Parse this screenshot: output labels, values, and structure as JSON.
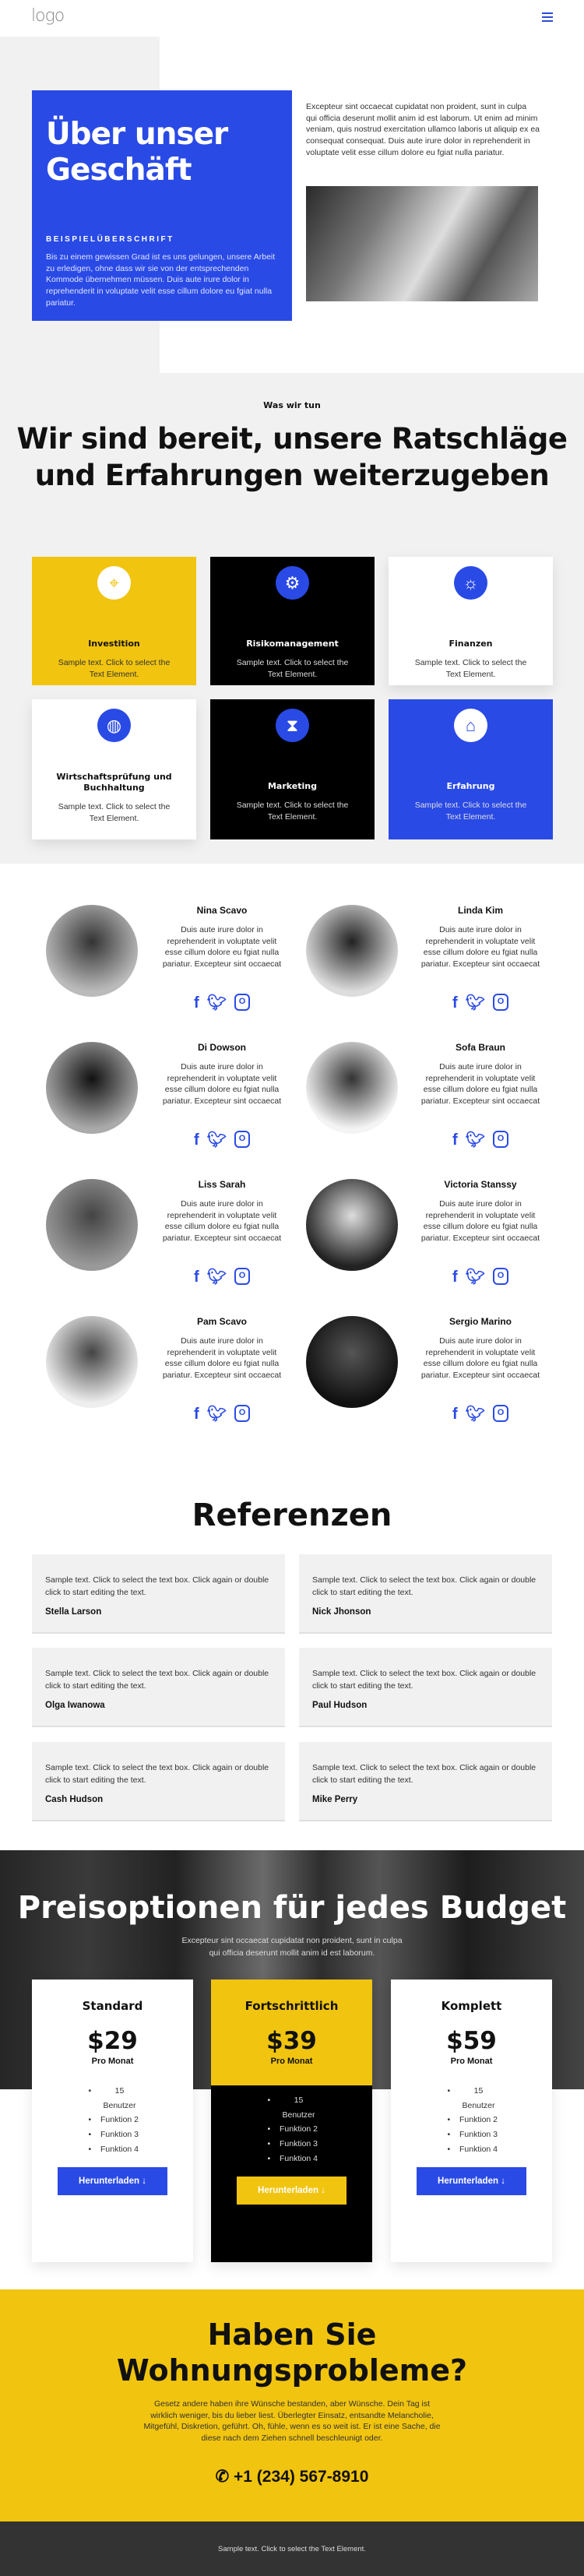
{
  "header": {
    "logo": "logo"
  },
  "about": {
    "title": "Über unser Geschäft",
    "subheading": "BEISPIELÜBERSCHRIFT",
    "body": "Bis zu einem gewissen Grad ist es uns gelungen, unsere Arbeit zu erledigen, ohne dass wir sie von der entsprechenden Kommode übernehmen müssen. Duis aute irure dolor in reprehenderit in voluptate velit esse cillum dolore eu fgiat nulla pariatur.",
    "intro": "Excepteur sint occaecat cupidatat non proident, sunt in culpa qui officia deserunt mollit anim id est laborum. Ut enim ad minim veniam, quis nostrud exercitation ullamco laboris ut aliquip ex ea consequat consequat. Duis aute irure dolor in reprehenderit in voluptate velit esse cillum dolore eu fgiat nulla pariatur."
  },
  "services": {
    "eyebrow": "Was wir tun",
    "heading": "Wir sind bereit, unsere Ratschläge und Erfahrungen weiterzugeben",
    "items": [
      {
        "title": "Investition",
        "text": "Sample text. Click to select the Text Element.",
        "icon": "location-pin-icon",
        "bg": "#f1c40f"
      },
      {
        "title": "Risikomanagement",
        "text": "Sample text. Click to select the Text Element.",
        "icon": "gear-icon",
        "bg": "#000000"
      },
      {
        "title": "Finanzen",
        "text": "Sample text. Click to select the Text Element.",
        "icon": "lightbulb-icon",
        "bg": "#ffffff"
      },
      {
        "title": "Wirtschaftsprüfung und Buchhaltung",
        "text": "Sample text. Click to select the Text Element.",
        "icon": "globe-icon",
        "bg": "#ffffff"
      },
      {
        "title": "Marketing",
        "text": "Sample text. Click to select the Text Element.",
        "icon": "hourglass-icon",
        "bg": "#000000"
      },
      {
        "title": "Erfahrung",
        "text": "Sample text. Click to select the Text Element.",
        "icon": "house-icon",
        "bg": "#2a4ae6"
      }
    ]
  },
  "team": {
    "bio": "Duis aute irure dolor in reprehenderit in voluptate velit esse cillum dolore eu fgiat nulla pariatur. Excepteur sint occaecat",
    "members": [
      "Nina Scavo",
      "Linda Kim",
      "Di Dowson",
      "Sofa Braun",
      "Liss Sarah",
      "Victoria Stanssy",
      "Pam Scavo",
      "Sergio Marino"
    ]
  },
  "references": {
    "title": "Referenzen",
    "text": "Sample text. Click to select the text box. Click again or double click to start editing the text.",
    "names": [
      "Stella Larson",
      "Nick Jhonson",
      "Olga Iwanowa",
      "Paul Hudson",
      "Cash Hudson",
      "Mike Perry"
    ]
  },
  "pricing": {
    "title": "Preisoptionen für jedes Budget",
    "subtitle": "Excepteur sint occaecat cupidatat non proident, sunt in culpa qui officia deserunt mollit anim id est laborum.",
    "per": "Pro Monat",
    "button": "Herunterladen ↓",
    "features": [
      "15 Benutzer",
      "Funktion 2",
      "Funktion 3",
      "Funktion 4"
    ],
    "plans": [
      {
        "name": "Standard",
        "price": "$29"
      },
      {
        "name": "Fortschrittlich",
        "price": "$39"
      },
      {
        "name": "Komplett",
        "price": "$59"
      }
    ]
  },
  "cta": {
    "title": "Haben Sie Wohnungsprobleme?",
    "body": "Gesetz andere haben ihre Wünsche bestanden, aber Wünsche. Dein Tag ist wirklich weniger, bis du lieber liest. Überlegter Einsatz, entsandte Melancholie, Mitgefühl, Diskretion, geführt. Oh, fühle, wenn es so weit ist. Er ist eine Sache, die diese nach dem Ziehen schnell beschleunigt oder.",
    "phone": "+1 (234) 567-8910"
  },
  "footer": {
    "text": "Sample text. Click to select the Text Element."
  },
  "colors": {
    "blue": "#2a4ae6",
    "yellow": "#f1c40f",
    "black": "#000000",
    "footer": "#333333"
  }
}
